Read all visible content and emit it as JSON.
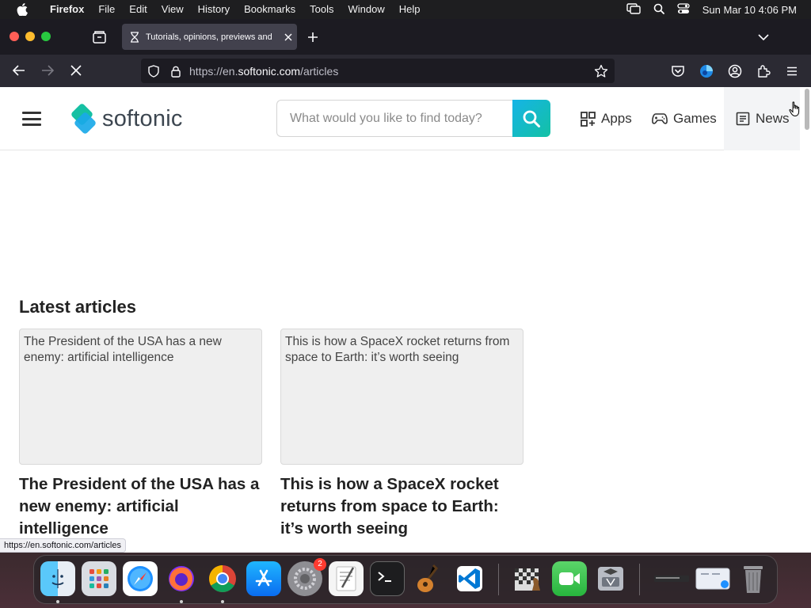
{
  "menubar": {
    "app_name": "Firefox",
    "items": [
      "File",
      "Edit",
      "View",
      "History",
      "Bookmarks",
      "Tools",
      "Window",
      "Help"
    ],
    "clock": "Sun Mar 10  4:06 PM"
  },
  "browser": {
    "tab_title": "Tutorials, opinions, previews and",
    "url_prefix": "https://en.",
    "url_domain": "softonic.com",
    "url_path": "/articles",
    "status_url": "https://en.softonic.com/articles"
  },
  "site": {
    "logo_text": "softonic",
    "search_placeholder": "What would you like to find today?",
    "nav": {
      "apps": "Apps",
      "games": "Games",
      "news": "News"
    },
    "section_title": "Latest articles",
    "articles": [
      {
        "thumb_alt": "The President of the USA has a new enemy: artificial intelligence",
        "headline": "The President of the USA has a new enemy: artificial intelligence"
      },
      {
        "thumb_alt": "This is how a SpaceX rocket returns from space to Earth: it’s worth seeing",
        "headline": "This is how a SpaceX rocket returns from space to Earth: it’s worth seeing"
      }
    ]
  },
  "dock": {
    "apps": [
      "Finder",
      "Launchpad",
      "Safari",
      "Firefox",
      "Chrome",
      "App Store",
      "System Settings",
      "TextEdit",
      "Terminal",
      "GarageBand",
      "Visual Studio Code",
      "Chess",
      "FaceTime",
      "Boot Camp Assistant",
      "Screenshot",
      "Preview",
      "Trash"
    ],
    "settings_badge": "2"
  },
  "colors": {
    "brand_blue": "#15b4e6",
    "brand_green": "#14c1a4",
    "tab_active": "#42414d",
    "toolbar": "#2b2a33"
  }
}
